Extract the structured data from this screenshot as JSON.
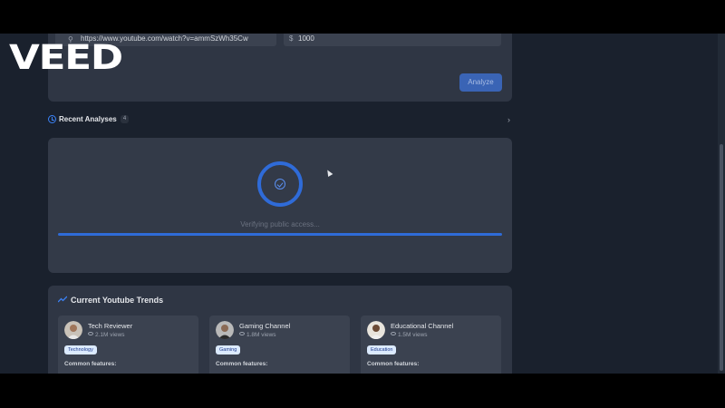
{
  "watermark": "VEED",
  "input": {
    "url_value": "https://www.youtube.com/watch?v=ammSzWh35Cw",
    "currency_symbol": "$",
    "amount_value": "1000",
    "analyze_label": "Analyze"
  },
  "recent": {
    "title": "Recent Analyses",
    "count": "4"
  },
  "loading": {
    "status": "Verifying public access...",
    "progress": 1.0
  },
  "trends": {
    "title": "Current Youtube Trends",
    "items": [
      {
        "name": "Tech Reviewer",
        "views": "2.1M views",
        "tag": "Technology",
        "features_label": "Common features:"
      },
      {
        "name": "Gaming Channel",
        "views": "1.8M views",
        "tag": "Gaming",
        "features_label": "Common features:"
      },
      {
        "name": "Educational Channel",
        "views": "1.5M views",
        "tag": "Education",
        "features_label": "Common features:"
      }
    ]
  },
  "colors": {
    "accent": "#2f6bd8",
    "card": "#2f3644",
    "background": "#1a212d"
  }
}
